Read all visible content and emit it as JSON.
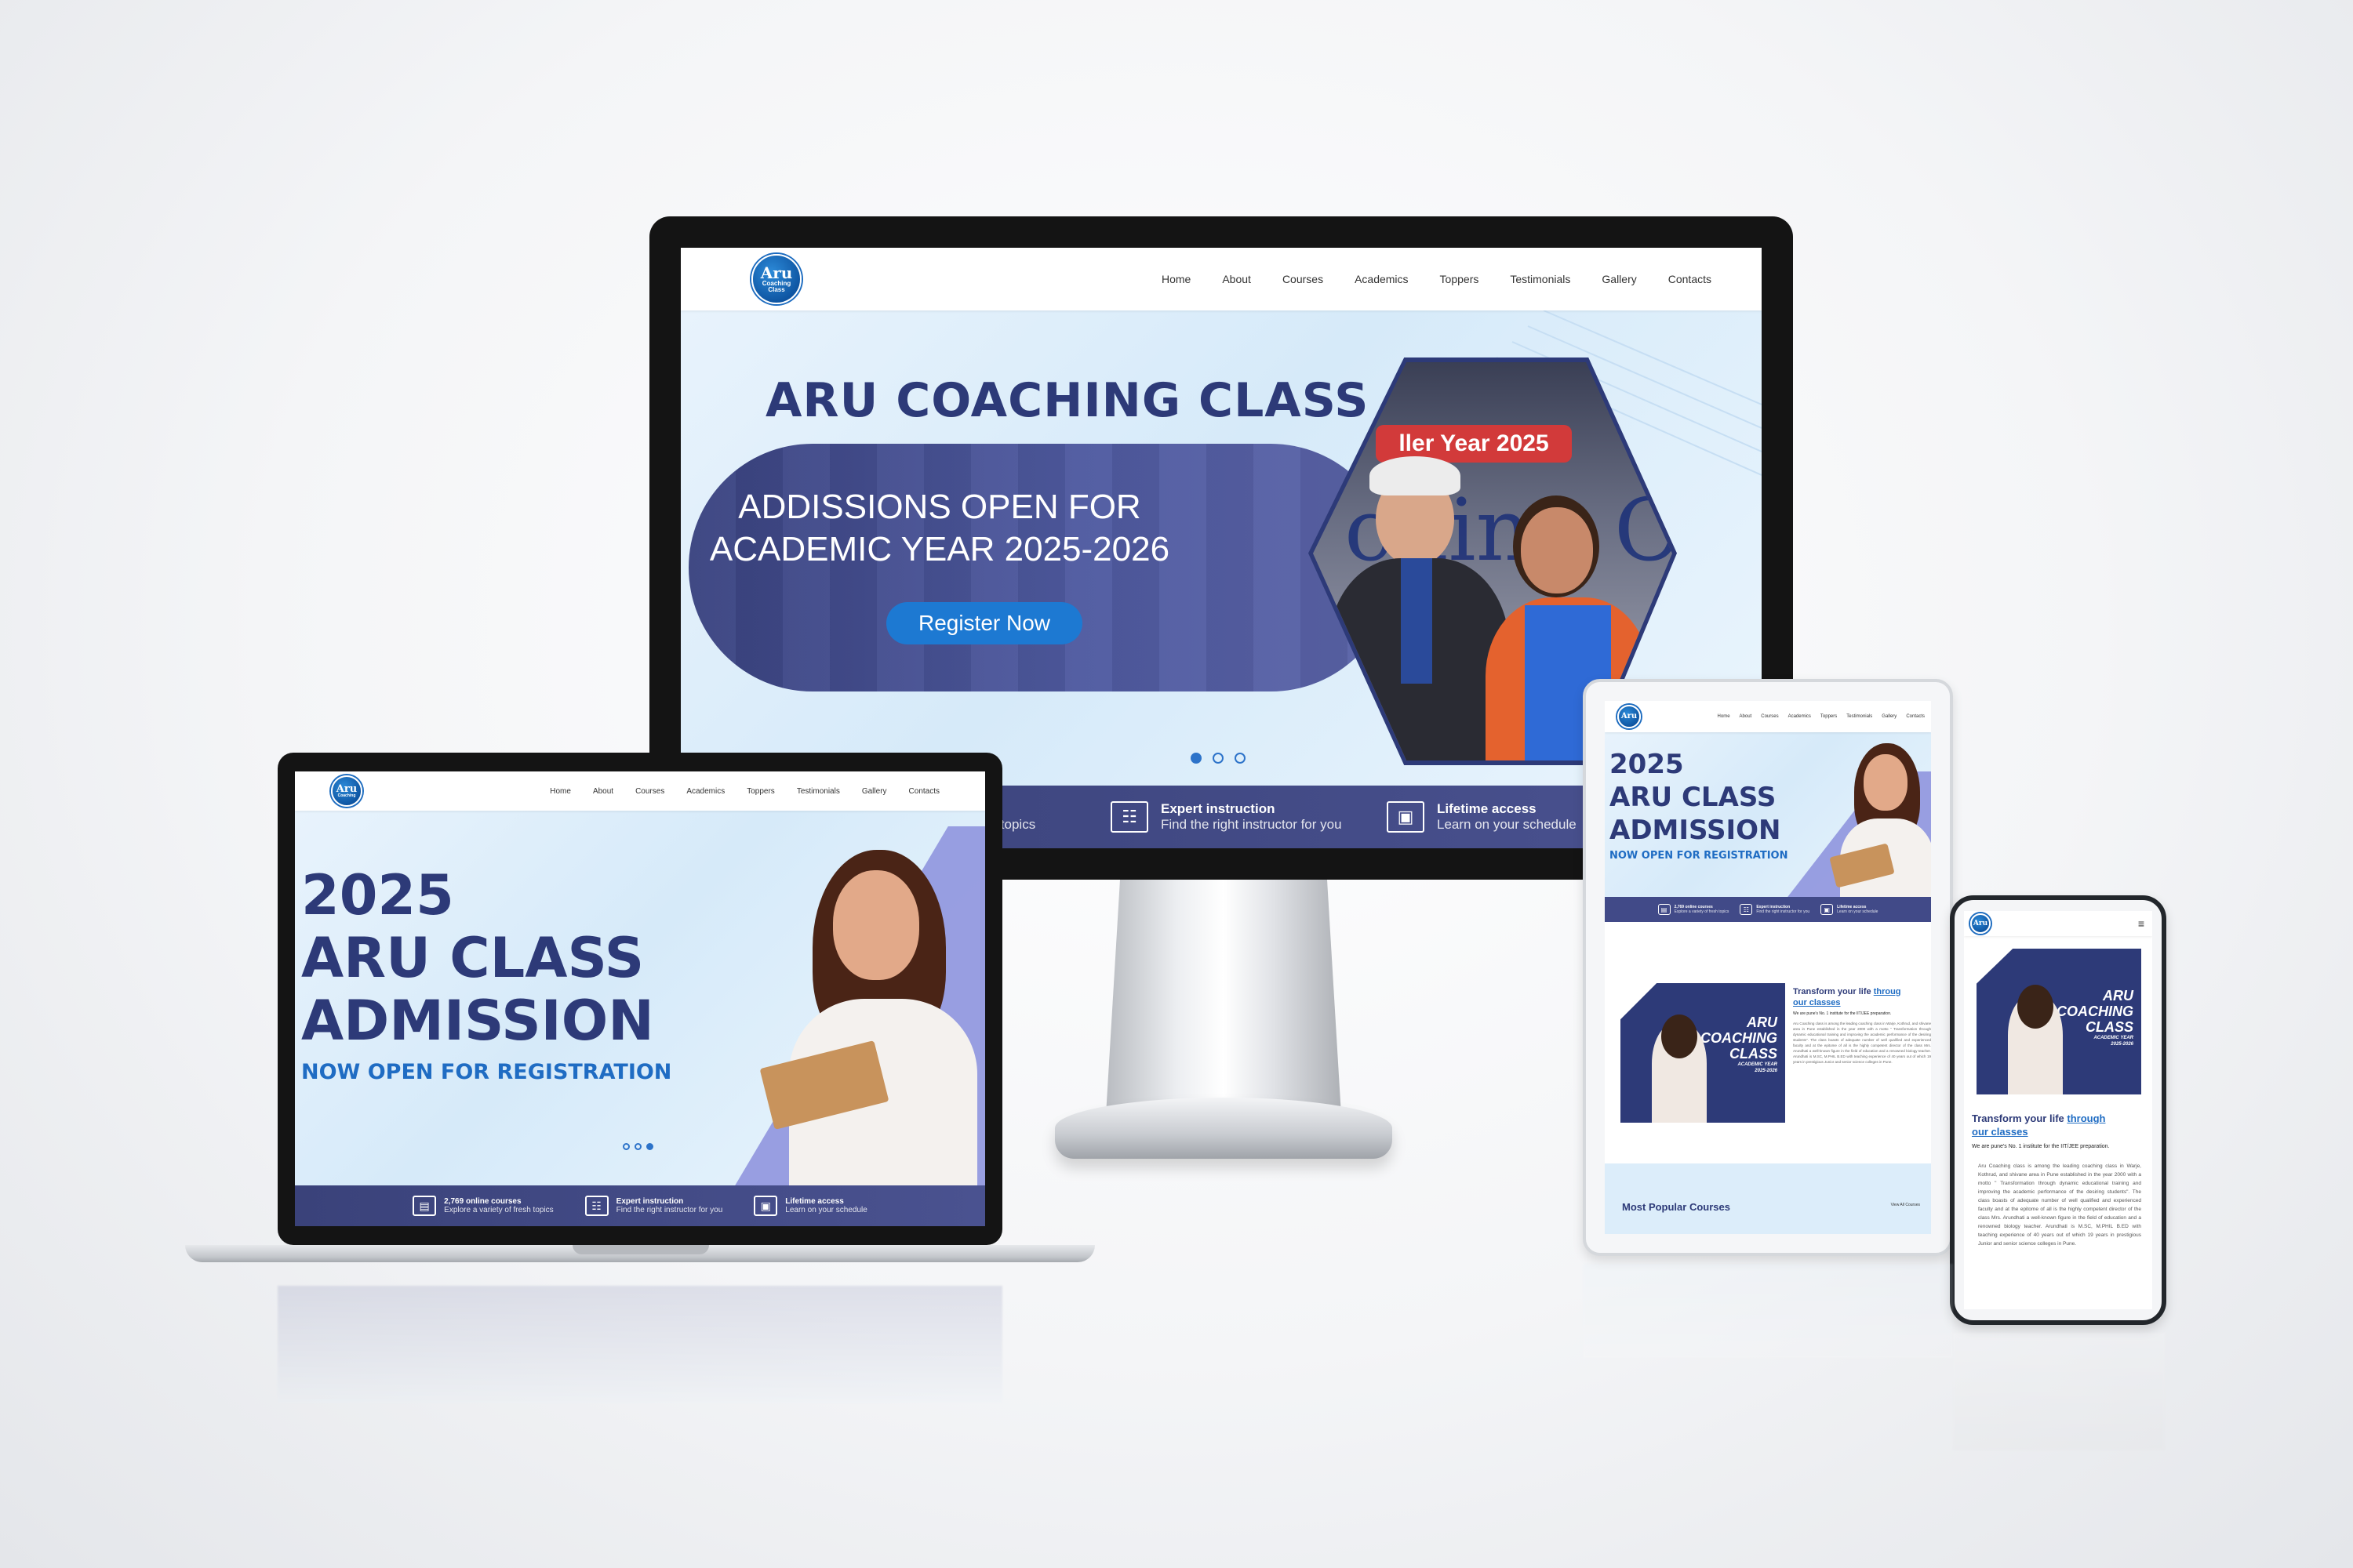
{
  "site": {
    "logo_line1": "Aru",
    "logo_line2": "Coaching",
    "logo_line3": "Class",
    "nav": [
      "Home",
      "About",
      "Courses",
      "Academics",
      "Toppers",
      "Testimonials",
      "Gallery",
      "Contacts"
    ]
  },
  "desktop_hero": {
    "title": "ARU COACHING CLASS",
    "line1": "ADDISSIONS OPEN FOR",
    "line2": "ACADEMIC YEAR 2025-2026",
    "cta": "Register Now",
    "banner_text": "ller Year 2025",
    "banner_bg_text": "ching Clas"
  },
  "features": [
    {
      "icon": "book-icon",
      "title": "2,769 online courses",
      "sub": "Explore a variety of fresh topics"
    },
    {
      "icon": "instructor-icon",
      "title": "Expert instruction",
      "sub": "Find the right instructor for you"
    },
    {
      "icon": "lifetime-icon",
      "title": "Lifetime access",
      "sub": "Learn on your schedule"
    }
  ],
  "desktop_features_partial": {
    "f1_title_cut": "es",
    "f1_sub_cut": "resh topics",
    "f3_sub_cut": "Learn on your schedule"
  },
  "admission_hero": {
    "year": "2025",
    "line1": "ARU CLASS",
    "line2": "ADMISSION",
    "sub": "NOW OPEN FOR REGISTRATION"
  },
  "about": {
    "poster_l1": "ARU",
    "poster_l2": "COACHING",
    "poster_l3": "CLASS",
    "poster_l4": "ACADEMIC YEAR",
    "poster_l5": "2025-2026",
    "heading_plain": "Transform your life ",
    "heading_link1": "throug",
    "heading_link_full": "through",
    "heading_link2": "our classes",
    "tagline": "We are pune's No. 1 institute for the IIT/JEE preparation.",
    "body": "Aru Coaching class is among the leading coaching class in Warje, Kothrud, and shivane area in Pune established in the year 2000 with a motto \" Transformation through dynamic educational training and improving the academic performance of the desiring students\". The class boasts of adequate number of well qualified and experienced faculty and at the epitome of all is the highly competent director of the class Mrs. Arundhati a well-known figure in the field of education and a renowned biology teacher. Arundhati is M.SC, M.PHIL B.ED with teaching experience of 40 years out of which 19 years in prestigious Junior and senior science colleges in Pune."
  },
  "courses": {
    "heading": "Most Popular Courses",
    "view_all": "View All Courses"
  },
  "colors": {
    "navy": "#2d3a78",
    "brand_blue": "#1f6cc3",
    "feature_bar": "#3f4784",
    "hero_bg": "#dcedfa"
  }
}
